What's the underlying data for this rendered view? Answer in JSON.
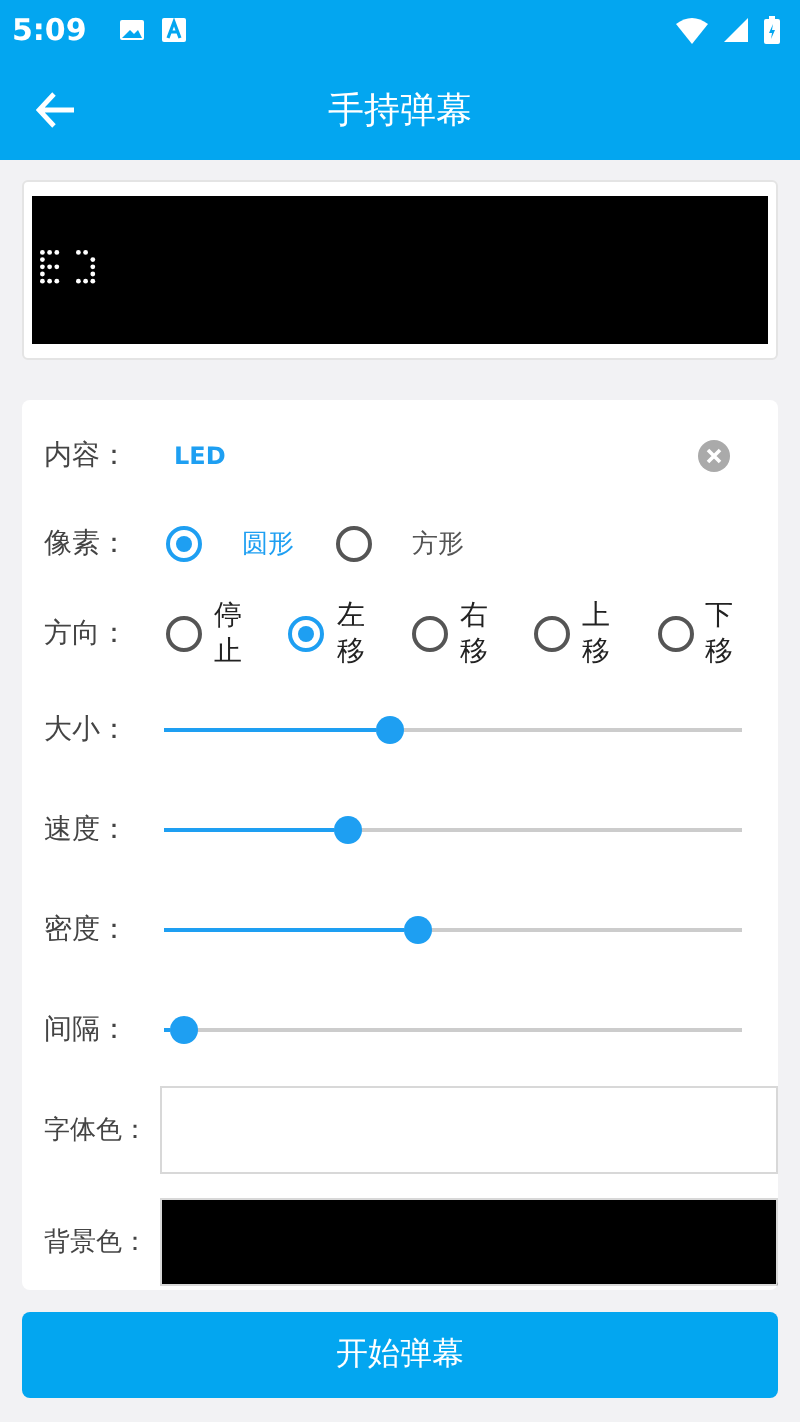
{
  "status_bar": {
    "time": "5:09"
  },
  "toolbar": {
    "title": "手持弹幕"
  },
  "content": {
    "label": "内容：",
    "value": "LED"
  },
  "pixel": {
    "label": "像素：",
    "options": [
      {
        "label": "圆形",
        "selected": true
      },
      {
        "label": "方形",
        "selected": false
      }
    ]
  },
  "direction": {
    "label": "方向：",
    "options": [
      {
        "label": "停止",
        "selected": false
      },
      {
        "label": "左移",
        "selected": true
      },
      {
        "label": "右移",
        "selected": false
      },
      {
        "label": "上移",
        "selected": false
      },
      {
        "label": "下移",
        "selected": false
      }
    ]
  },
  "sliders": [
    {
      "label": "大小：",
      "level": 0.39
    },
    {
      "label": "速度：",
      "level": 0.32
    },
    {
      "label": "密度：",
      "level": 0.44
    },
    {
      "label": "间隔：",
      "level": 0.035
    }
  ],
  "colors": [
    {
      "label": "字体色：",
      "color": "#ffffff"
    },
    {
      "label": "背景色：",
      "color": "#000000"
    }
  ],
  "start_button": "开始弹幕"
}
